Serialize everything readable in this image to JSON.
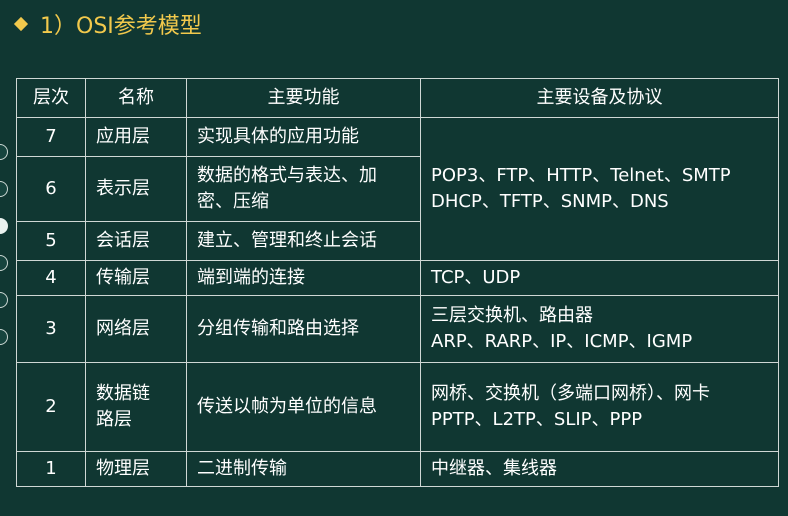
{
  "heading": "1）OSI参考模型",
  "table": {
    "headers": [
      "层次",
      "名称",
      "主要功能",
      "主要设备及协议"
    ],
    "rows": [
      {
        "layer": "7",
        "name": "应用层",
        "function": "实现具体的应用功能"
      },
      {
        "layer": "6",
        "name": "表示层",
        "function": [
          "数据的格式与表达、加",
          "密、压缩"
        ]
      },
      {
        "layer": "5",
        "name": "会话层",
        "function": "建立、管理和终止会话"
      },
      {
        "layer": "4",
        "name": "传输层",
        "function": "端到端的连接",
        "devices": "TCP、UDP"
      },
      {
        "layer": "3",
        "name": "网络层",
        "function": "分组传输和路由选择",
        "devices": [
          "三层交换机、路由器",
          "ARP、RARP、IP、ICMP、IGMP"
        ]
      },
      {
        "layer": "2",
        "name": [
          "数据链",
          "路层"
        ],
        "function": "传送以帧为单位的信息",
        "devices": [
          "网桥、交换机（多端口网桥）、网卡",
          "PPTP、L2TP、SLIP、PPP"
        ]
      },
      {
        "layer": "1",
        "name": "物理层",
        "function": "二进制传输",
        "devices": "中继器、集线器"
      }
    ],
    "upper_devices": [
      "POP3、FTP、HTTP、Telnet、SMTP",
      "DHCP、TFTP、SNMP、DNS"
    ]
  },
  "colors": {
    "background": "#103732",
    "heading": "#f2c94c",
    "text": "#ffffff",
    "border": "#cfd8d5"
  }
}
